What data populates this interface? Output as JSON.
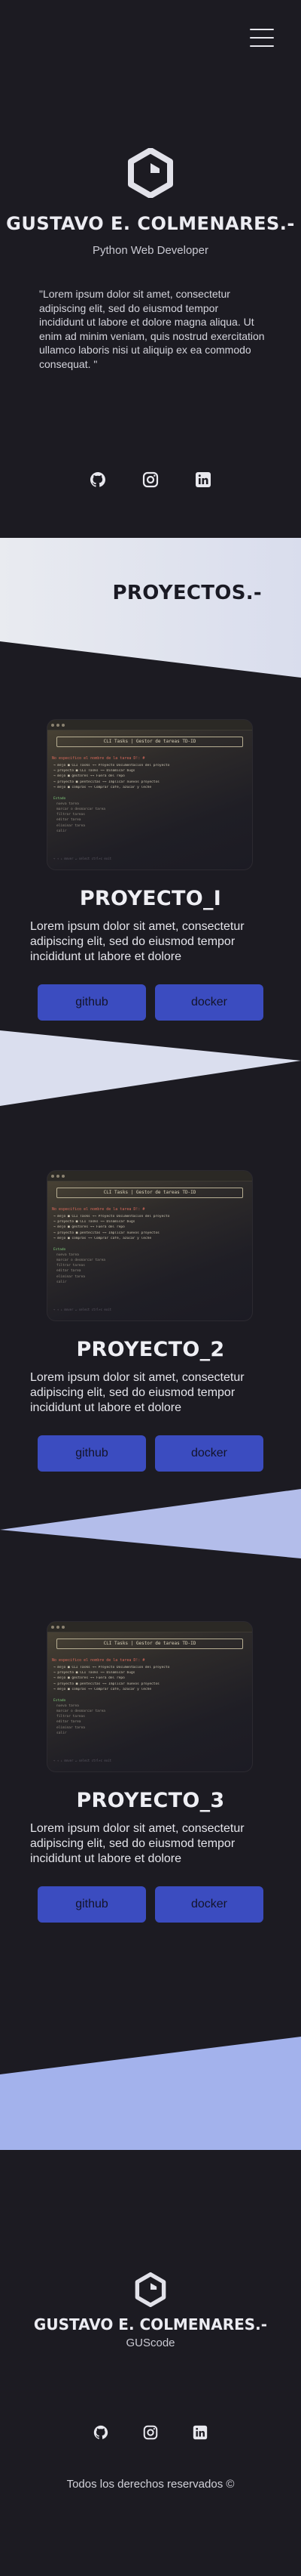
{
  "hero": {
    "name": "GUSTAVO E. COLMENARES.-",
    "role": "Python Web Developer",
    "quote": "\"Lorem ipsum dolor sit amet, consectetur adipiscing elit, sed do eiusmod tempor incididunt ut labore et dolore magna aliqua. Ut enim ad minim veniam, quis nostrud exercitation ullamco laboris nisi ut aliquip ex ea commodo consequat. \""
  },
  "social_icons": [
    "github-icon",
    "instagram-icon",
    "linkedin-icon"
  ],
  "projects_section": {
    "title": "PROYECTOS.-"
  },
  "screenshot_text": {
    "command": "CLI Tasks | Gestor de tareas TD-ID",
    "prompt": "No especifico el nombre de la tarea D!: #",
    "rows": [
      "→  mejo     ■  CLI Tasks      →→ Proyecto Documentacion del proyecto",
      "→  proyecto ■  CLI Tasks      →→ Dinamicar bugs",
      "→  mejo     ■  gestores       →→ Fuera del repo",
      "→  proyecto ■  pentecitas     →→ Implicar nuevos proyectos",
      "→  mejo     ■  compras        →→ Comprar café, azúcar y leche"
    ],
    "status": "Estado",
    "sub_items": [
      "nueva tarea",
      "marcar o desmarcar tarea",
      "filtrar tareas",
      "editar tarea",
      "eliminar tarea",
      "salir"
    ],
    "footer": "→ ↑ ↓ mover  ↵ select  ctrl+c exit"
  },
  "projects": [
    {
      "title": "PROYECTO_I",
      "description": "Lorem ipsum dolor sit amet, consectetur adipiscing elit, sed do eiusmod tempor incididunt ut labore et dolore",
      "github_label": "github",
      "docker_label": "docker"
    },
    {
      "title": "PROYECTO_2",
      "description": "Lorem ipsum dolor sit amet, consectetur adipiscing elit, sed do eiusmod tempor incididunt ut labore et dolore",
      "github_label": "github",
      "docker_label": "docker"
    },
    {
      "title": "PROYECTO_3",
      "description": "Lorem ipsum dolor sit amet, consectetur adipiscing elit, sed do eiusmod tempor incididunt ut labore et dolore",
      "github_label": "github",
      "docker_label": "docker"
    }
  ],
  "footer": {
    "name": "GUSTAVO E. COLMENARES.-",
    "subtitle": "GUScode",
    "copyright": "Todos los derechos reservados ©"
  },
  "colors": {
    "background": "#1c1b22",
    "button": "#3b4cc0",
    "wedge_light": "#d8dcee",
    "wedge_blue": "#a7b4ec"
  }
}
